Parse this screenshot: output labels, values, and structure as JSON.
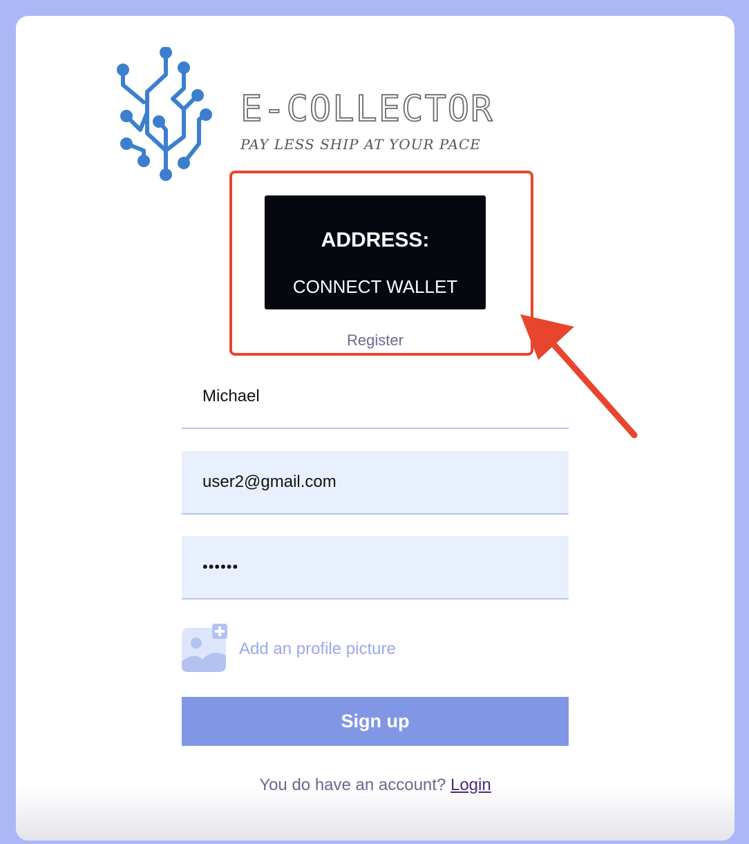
{
  "brand": {
    "name": "E-COLLECTOR",
    "tagline": "PAY LESS SHIP AT YOUR PACE",
    "logo_icon": "circuit-tree-logo",
    "logo_color": "#3b7fce"
  },
  "wallet": {
    "title": "ADDRESS:",
    "button_label": "CONNECT WALLET",
    "register_label": "Register"
  },
  "annotation": {
    "highlight_color": "#e8452f",
    "arrow_icon": "red-arrow-annotation"
  },
  "form": {
    "name_value": "Michael",
    "email_value": "user2@gmail.com",
    "password_value": "••••••",
    "upload_icon": "add-image-icon",
    "upload_label": "Add an profile picture",
    "signup_label": "Sign up"
  },
  "footer": {
    "prompt": "You do have an account?",
    "login_label": "Login"
  },
  "colors": {
    "page_background": "#aab9f5",
    "signup_button": "#8197e6",
    "input_fill": "#e8f0fd"
  }
}
